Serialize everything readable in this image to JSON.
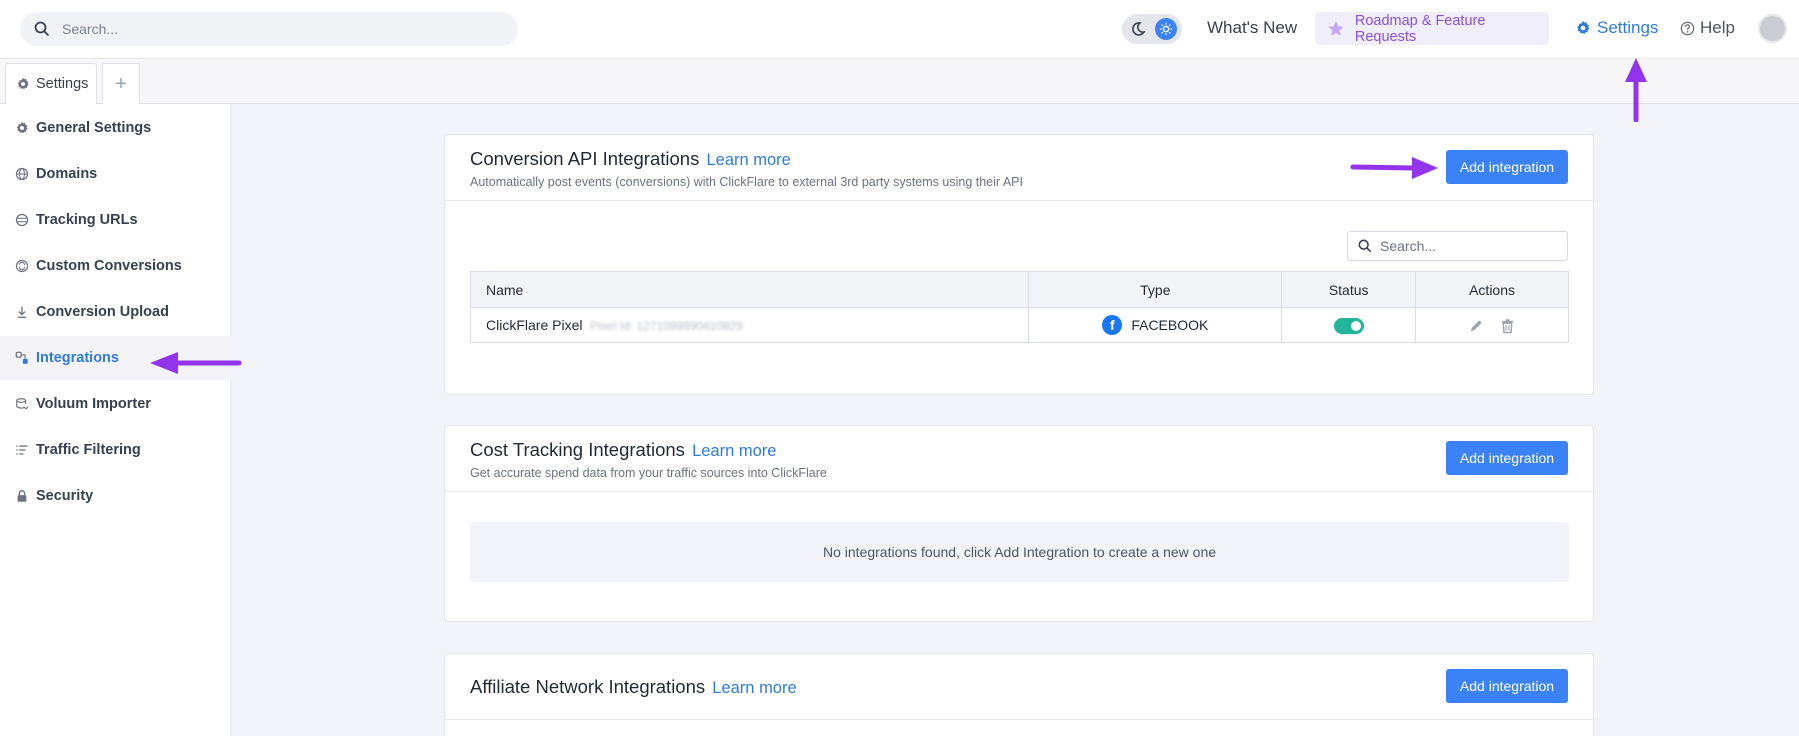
{
  "topbar": {
    "search_placeholder": "Search...",
    "whats_new": "What's New",
    "roadmap": "Roadmap & Feature Requests",
    "settings": "Settings",
    "help": "Help"
  },
  "tabs": {
    "active_label": "Settings",
    "add_symbol": "+"
  },
  "sidebar": {
    "items": [
      {
        "label": "General Settings",
        "icon": "gear-icon"
      },
      {
        "label": "Domains",
        "icon": "globe-icon"
      },
      {
        "label": "Tracking URLs",
        "icon": "link-icon"
      },
      {
        "label": "Custom Conversions",
        "icon": "conversion-icon"
      },
      {
        "label": "Conversion Upload",
        "icon": "upload-icon"
      },
      {
        "label": "Integrations",
        "icon": "integrations-icon"
      },
      {
        "label": "Voluum Importer",
        "icon": "import-icon"
      },
      {
        "label": "Traffic Filtering",
        "icon": "filter-icon"
      },
      {
        "label": "Security",
        "icon": "lock-icon"
      }
    ],
    "active": "Integrations"
  },
  "cards": {
    "conversion": {
      "title": "Conversion API Integrations",
      "learn_more": "Learn more",
      "subtitle": "Automatically post events (conversions) with ClickFlare to external 3rd party systems using their API",
      "add_button": "Add integration",
      "search_placeholder": "Search...",
      "columns": [
        "Name",
        "Type",
        "Status",
        "Actions"
      ],
      "rows": [
        {
          "name": "ClickFlare Pixel",
          "pixel_id": "Pixel Id: 1271099990410829",
          "type": "FACEBOOK",
          "status": "on"
        }
      ]
    },
    "cost": {
      "title": "Cost Tracking Integrations",
      "learn_more": "Learn more",
      "subtitle": "Get accurate spend data from your traffic sources into ClickFlare",
      "add_button": "Add integration",
      "empty_message": "No integrations found, click Add Integration to create a new one"
    },
    "affiliate": {
      "title": "Affiliate Network Integrations",
      "learn_more": "Learn more",
      "add_button": "Add integration"
    }
  },
  "colors": {
    "accent": "#3b82f6",
    "link": "#2f7bdc",
    "annotation_arrow": "#9333ea",
    "toggle_on": "#22b59a"
  }
}
